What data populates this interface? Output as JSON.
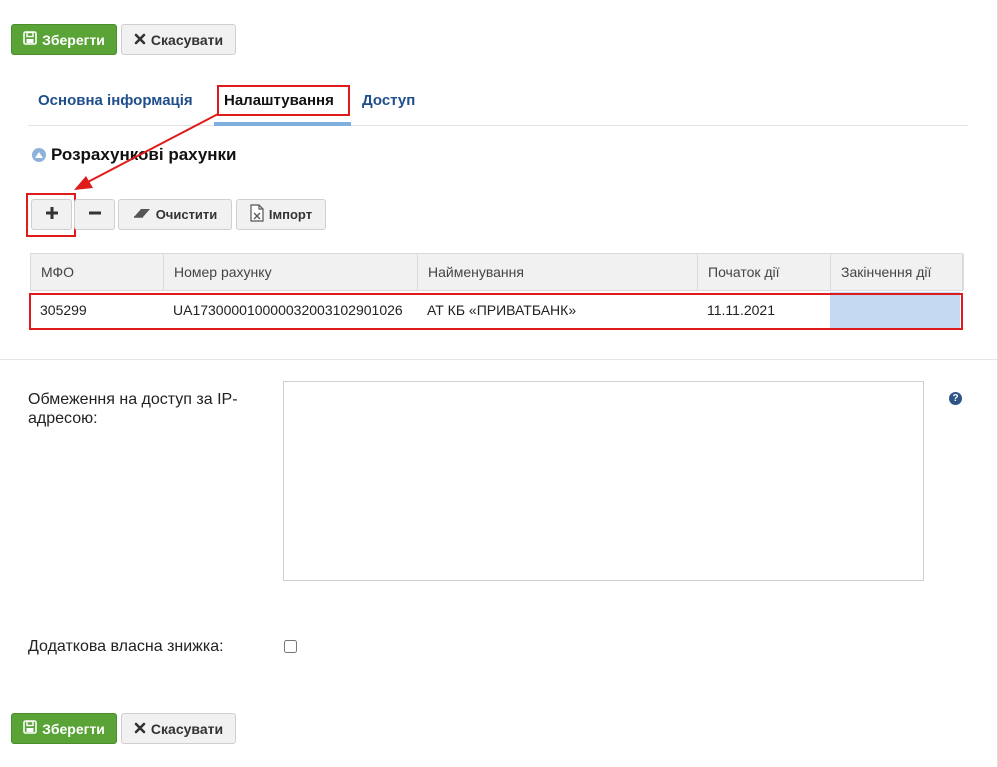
{
  "actions": {
    "save_label": "Зберегти",
    "cancel_label": "Скасувати"
  },
  "tabs": [
    {
      "label": "Основна інформація"
    },
    {
      "label": "Налаштування"
    },
    {
      "label": "Доступ"
    }
  ],
  "section": {
    "title": "Розрахункові рахунки"
  },
  "toolbar": {
    "clear_label": "Очистити",
    "import_label": "Імпорт"
  },
  "table": {
    "columns": [
      "МФО",
      "Номер рахунку",
      "Найменування",
      "Початок дії",
      "Закінчення дії"
    ],
    "rows": [
      [
        "305299",
        "UA173000010000032003102901026",
        "АТ КБ «ПРИВАТБАНК»",
        "11.11.2021",
        ""
      ]
    ]
  },
  "form": {
    "ip_label": "Обмеження на доступ за IP-адресою:",
    "ip_value": "",
    "discount_label": "Додаткова власна знижка:",
    "discount_checked": false
  },
  "colors": {
    "accent_green": "#5aa337",
    "link_blue": "#1f4e8c",
    "highlight_red": "#e01b1b",
    "selection_blue": "#c3d9f1"
  },
  "icons": [
    "save-icon",
    "close-icon",
    "collapse-up-icon",
    "plus-icon",
    "minus-icon",
    "eraser-icon",
    "excel-file-icon",
    "help-icon",
    "arrow-annotation"
  ]
}
